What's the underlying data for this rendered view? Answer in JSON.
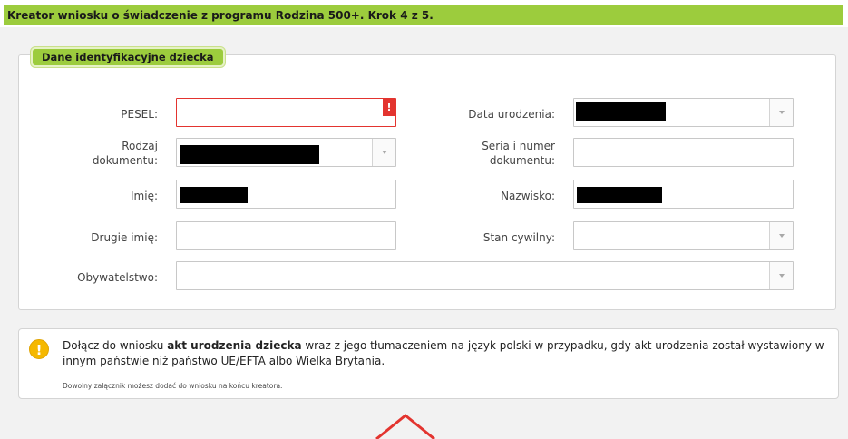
{
  "window": {
    "title": "Kreator wniosku o świadczenie z programu Rodzina 500+. Krok 4 z 5."
  },
  "section": {
    "legend": "Dane identyfikacyjne dziecka"
  },
  "form": {
    "pesel": {
      "label": "PESEL:",
      "value": "",
      "error_marker": "!"
    },
    "birth_date": {
      "label": "Data urodzenia:"
    },
    "doc_type": {
      "label_line1": "Rodzaj",
      "label_line2": "dokumentu:"
    },
    "doc_number": {
      "label_line1": "Seria i numer",
      "label_line2": "dokumentu:",
      "value": ""
    },
    "first_name": {
      "label": "Imię:"
    },
    "last_name": {
      "label": "Nazwisko:"
    },
    "second_name": {
      "label": "Drugie imię:",
      "value": ""
    },
    "marital_status": {
      "label": "Stan cywilny:",
      "value": ""
    },
    "citizenship": {
      "label": "Obywatelstwo:",
      "value": ""
    }
  },
  "notice": {
    "icon": "exclamation-icon",
    "icon_glyph": "!",
    "text_before": "Dołącz do wniosku ",
    "text_bold": "akt urodzenia dziecka",
    "text_after": " wraz z jego tłumaczeniem na język polski w przypadku, gdy akt urodzenia został wystawiony w innym państwie niż państwo UE/EFTA albo Wielka Brytania.",
    "small": "Dowolny załącznik możesz dodać do wniosku na końcu kreatora."
  },
  "colors": {
    "accent_green": "#9ccc3d",
    "error_red": "#e3342f",
    "warning_yellow": "#f5b800"
  }
}
